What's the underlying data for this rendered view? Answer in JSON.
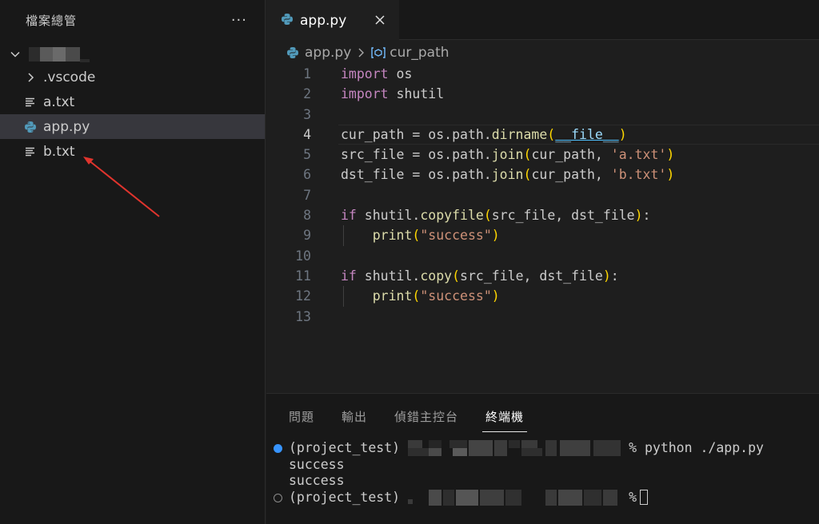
{
  "explorer": {
    "title": "檔案總管",
    "more_glyph": "···",
    "files": [
      {
        "label": ".vscode",
        "icon": "chevron-right-icon"
      },
      {
        "label": "a.txt",
        "icon": "text-file-icon"
      },
      {
        "label": "app.py",
        "icon": "python-icon",
        "selected": true
      },
      {
        "label": "b.txt",
        "icon": "text-file-icon"
      }
    ]
  },
  "editor": {
    "tab_label": "app.py",
    "breadcrumb": {
      "file": "app.py",
      "symbol": "cur_path"
    },
    "active_line": 4,
    "line_numbers": [
      "1",
      "2",
      "3",
      "4",
      "5",
      "6",
      "7",
      "8",
      "9",
      "10",
      "11",
      "12",
      "13"
    ],
    "lines": [
      "import os",
      "import shutil",
      "",
      "cur_path = os.path.dirname(__file__)",
      "src_file = os.path.join(cur_path, 'a.txt')",
      "dst_file = os.path.join(cur_path, 'b.txt')",
      "",
      "if shutil.copyfile(src_file, dst_file):",
      "    print(\"success\")",
      "",
      "if shutil.copy(src_file, dst_file):",
      "    print(\"success\")",
      ""
    ]
  },
  "panel": {
    "tabs": [
      "問題",
      "輸出",
      "偵錯主控台",
      "終端機"
    ],
    "active_tab": "終端機",
    "terminal": {
      "prompt_env": "(project_test)",
      "command": "% python ./app.py",
      "outputs": [
        "success",
        "success"
      ],
      "prompt_end": "%"
    }
  },
  "colors": {
    "keyword": "#c586c0",
    "function": "#dcdcaa",
    "string": "#ce9178",
    "bracket": "#ffd700",
    "annotation_arrow": "#e0342d"
  }
}
